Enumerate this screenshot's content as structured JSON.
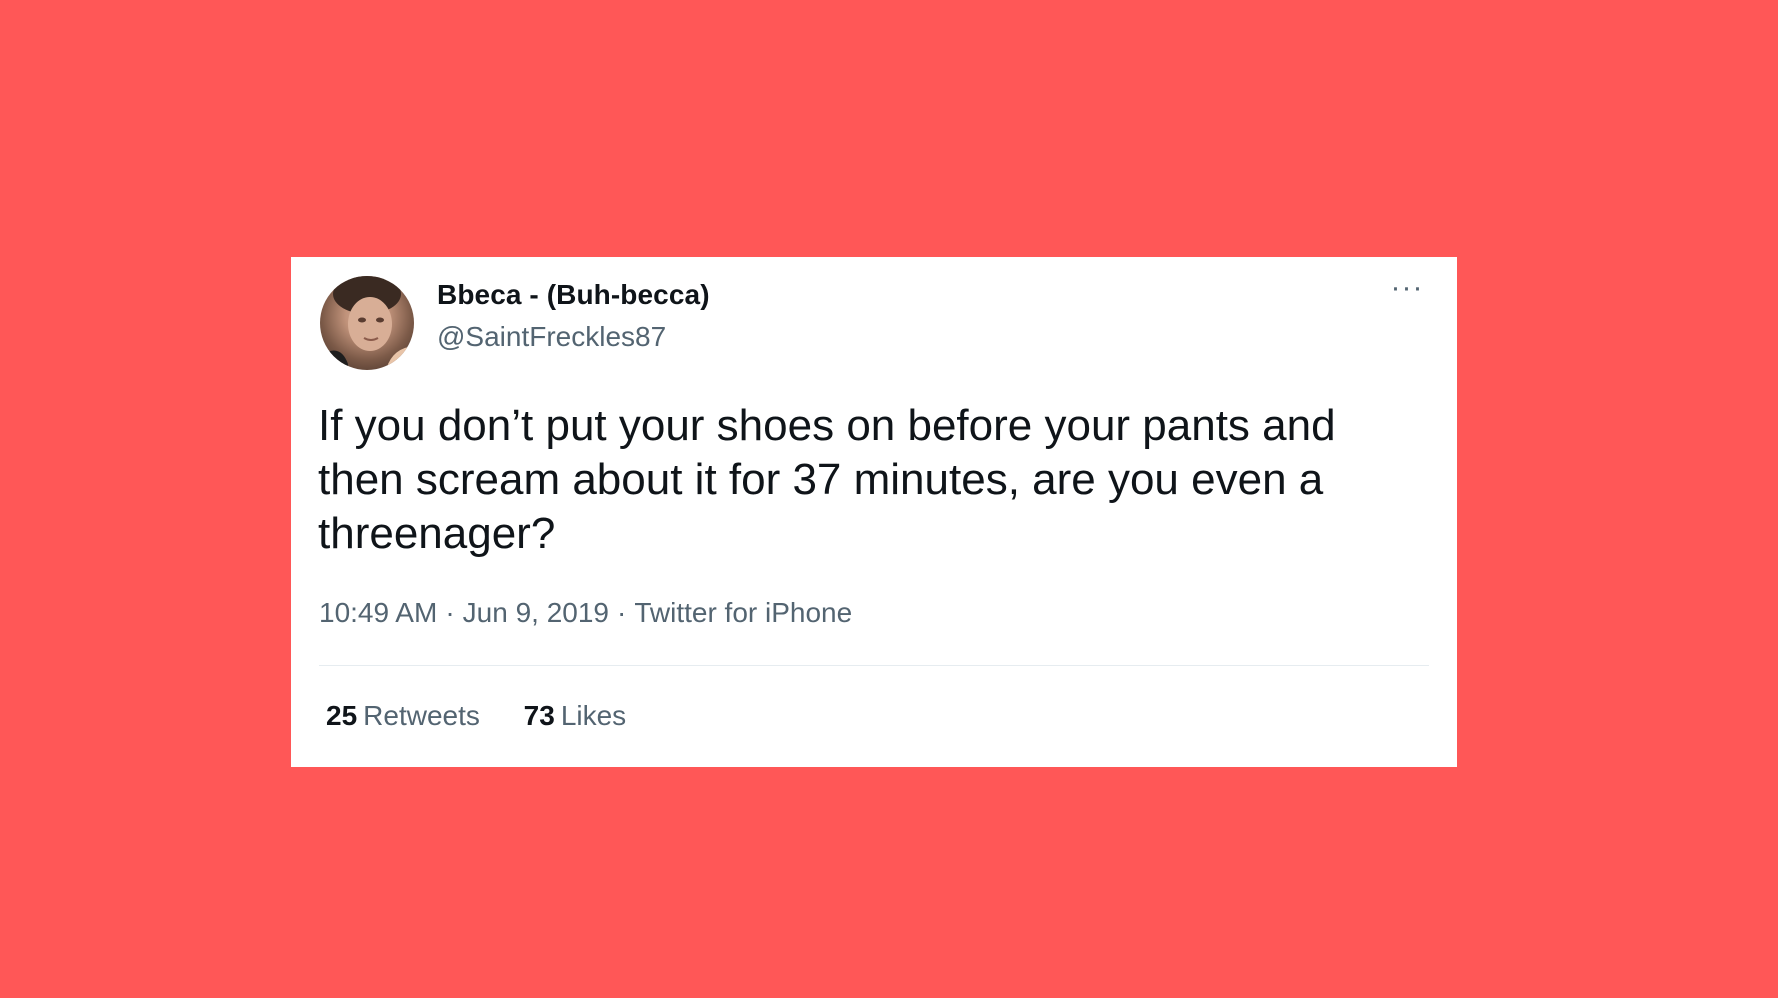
{
  "colors": {
    "background": "#ff5757",
    "card": "#ffffff",
    "primary_text": "#0f1419",
    "secondary_text": "#536471"
  },
  "tweet": {
    "author": {
      "display_name": "Bbeca - (Buh-becca)",
      "handle": "@SaintFreckles87",
      "avatar_icon": "profile-photo"
    },
    "more_icon": "more-options-icon",
    "more_label": "···",
    "text": "If you don’t put your shoes on before your pants and then scream about it for 37 minutes, are you even a threenager?",
    "time": "10:49 AM",
    "separator": "·",
    "date": "Jun 9, 2019",
    "source": "Twitter for iPhone",
    "stats": {
      "retweets_count": "25",
      "retweets_label": "Retweets",
      "likes_count": "73",
      "likes_label": "Likes"
    }
  }
}
